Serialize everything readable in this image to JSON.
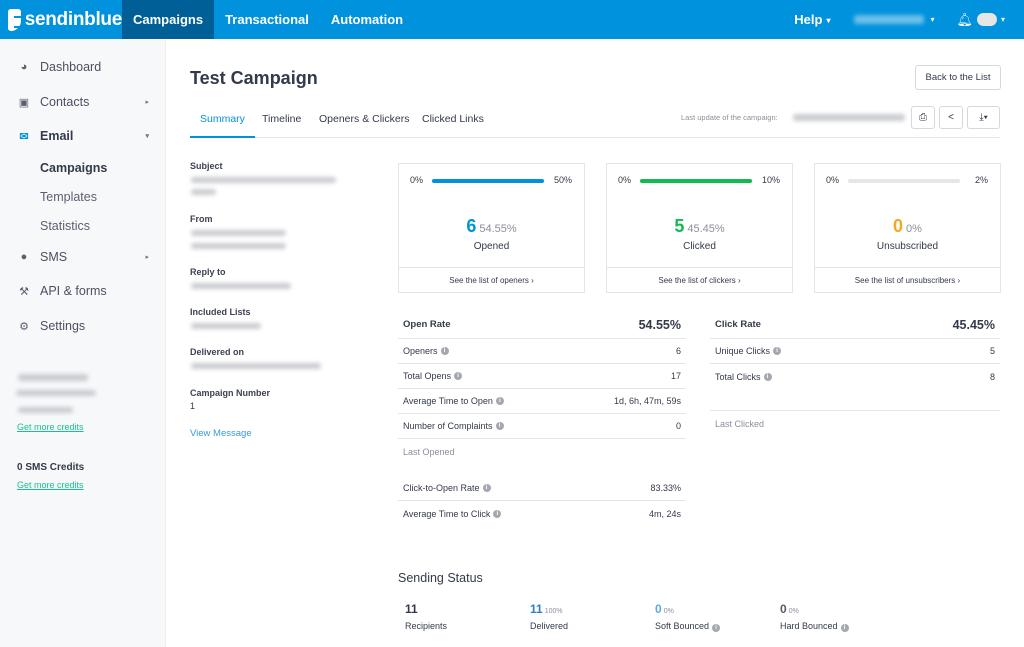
{
  "topbar": {
    "brand": "sendinblue",
    "tabs": [
      {
        "label": "Campaigns",
        "active": true
      },
      {
        "label": "Transactional",
        "active": false
      },
      {
        "label": "Automation",
        "active": false
      }
    ],
    "help_label": "Help",
    "icons": {
      "caret": "▾",
      "bell": "🔔"
    }
  },
  "sidebar": {
    "items": [
      {
        "label": "Dashboard",
        "icon": "dashboard-icon",
        "glyph": "◕"
      },
      {
        "label": "Contacts",
        "icon": "contacts-icon",
        "glyph": "▣",
        "arrow": "▸"
      },
      {
        "label": "Email",
        "icon": "envelope-icon",
        "glyph": "✉",
        "arrow": "▾"
      },
      {
        "label": "SMS",
        "icon": "chat-icon",
        "glyph": "●",
        "arrow": "▸"
      },
      {
        "label": "API & forms",
        "icon": "wrench-icon",
        "glyph": "⚒"
      },
      {
        "label": "Settings",
        "icon": "gear-icon",
        "glyph": "⚙"
      }
    ],
    "email_sub": [
      "Campaigns",
      "Templates",
      "Statistics"
    ],
    "get_more_credits": "Get more credits",
    "sms_credits": "0 SMS Credits",
    "get_more_credits_sms": "Get more credits"
  },
  "page": {
    "title": "Test Campaign",
    "back_button": "Back to the List",
    "tabs": [
      "Summary",
      "Timeline",
      "Openers & Clickers",
      "Clicked Links"
    ],
    "last_update_label": "Last update of the campaign:",
    "icons": {
      "print": "⎙",
      "share": "<",
      "download": "⤓▾"
    }
  },
  "details": {
    "subject_label": "Subject",
    "from_label": "From",
    "reply_to_label": "Reply to",
    "included_lists_label": "Included Lists",
    "delivered_on_label": "Delivered on",
    "campaign_number_label": "Campaign Number",
    "campaign_number": "1",
    "view_message": "View Message"
  },
  "cards": [
    {
      "min": "0%",
      "max": "50%",
      "progress": 1.0,
      "color": "#0092dd",
      "count": "6",
      "percent": "54.55%",
      "label": "Opened",
      "link": "See the list of openers ›"
    },
    {
      "min": "0%",
      "max": "10%",
      "progress": 1.0,
      "color": "#13b955",
      "count": "5",
      "percent": "45.45%",
      "label": "Clicked",
      "link": "See the list of clickers ›"
    },
    {
      "min": "0%",
      "max": "2%",
      "progress": 0.0,
      "color": "#f5a623",
      "count": "0",
      "percent": "0%",
      "label": "Unsubscribed",
      "link": "See the list of unsubscribers ›"
    }
  ],
  "open_stats": {
    "head": {
      "label": "Open Rate",
      "value": "54.55%"
    },
    "rows": [
      {
        "label": "Openers",
        "value": "6"
      },
      {
        "label": "Total Opens",
        "value": "17"
      },
      {
        "label": "Average Time to Open",
        "value": "1d, 6h, 47m, 59s"
      },
      {
        "label": "Number of Complaints",
        "value": "0"
      }
    ],
    "last_opened": "Last Opened",
    "extra": [
      {
        "label": "Click-to-Open Rate",
        "value": "83.33%"
      },
      {
        "label": "Average Time to Click",
        "value": "4m, 24s"
      }
    ]
  },
  "click_stats": {
    "head": {
      "label": "Click Rate",
      "value": "45.45%"
    },
    "rows": [
      {
        "label": "Unique Clicks",
        "value": "5"
      },
      {
        "label": "Total Clicks",
        "value": "8"
      }
    ],
    "last_clicked": "Last Clicked"
  },
  "sending_status": {
    "title": "Sending Status",
    "items": [
      {
        "count": "11",
        "percent": "",
        "label": "Recipients",
        "color": "#333a4a",
        "info": false
      },
      {
        "count": "11",
        "percent": "100%",
        "label": "Delivered",
        "color": "#2d7fc1",
        "info": false
      },
      {
        "count": "0",
        "percent": "0%",
        "label": "Soft Bounced",
        "color": "#5aa9e0",
        "info": true
      },
      {
        "count": "0",
        "percent": "0%",
        "label": "Hard Bounced",
        "color": "#555b68",
        "info": true
      }
    ]
  }
}
